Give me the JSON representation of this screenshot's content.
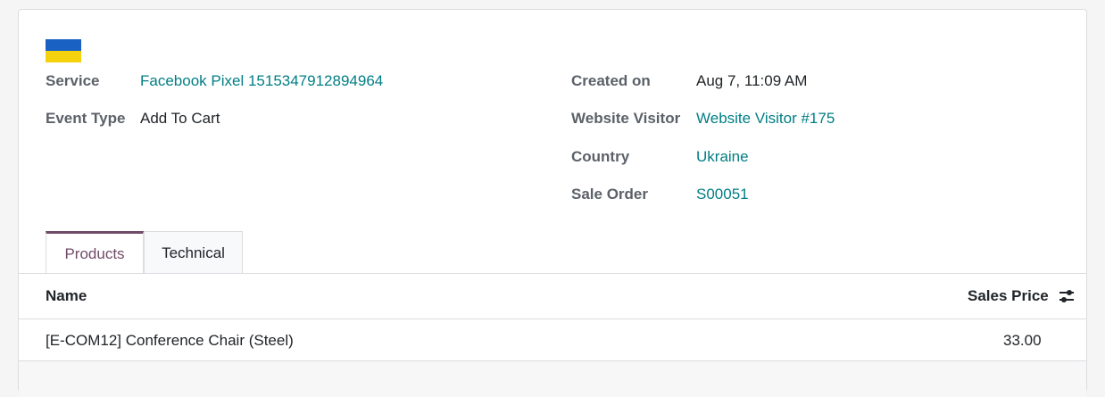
{
  "record": {
    "service_label": "Service",
    "service_value": "Facebook Pixel 1515347912894964",
    "event_type_label": "Event Type",
    "event_type_value": "Add To Cart",
    "created_on_label": "Created on",
    "created_on_value": "Aug 7, 11:09 AM",
    "website_visitor_label": "Website Visitor",
    "website_visitor_value": "Website Visitor #175",
    "country_label": "Country",
    "country_value": "Ukraine",
    "sale_order_label": "Sale Order",
    "sale_order_value": "S00051"
  },
  "flag": {
    "icon": "ukraine-flag-icon",
    "top_color": "#1a61c4",
    "bottom_color": "#f5d20e"
  },
  "tabs": [
    {
      "label": "Products",
      "active": true
    },
    {
      "label": "Technical",
      "active": false
    }
  ],
  "table": {
    "columns": [
      "Name",
      "Sales Price"
    ],
    "rows": [
      {
        "name": "[E-COM12] Conference Chair (Steel)",
        "sales_price": "33.00"
      }
    ],
    "settings_icon": "optional-columns-toggle-icon"
  },
  "colors": {
    "accent": "#714b67",
    "link": "#017e84"
  }
}
